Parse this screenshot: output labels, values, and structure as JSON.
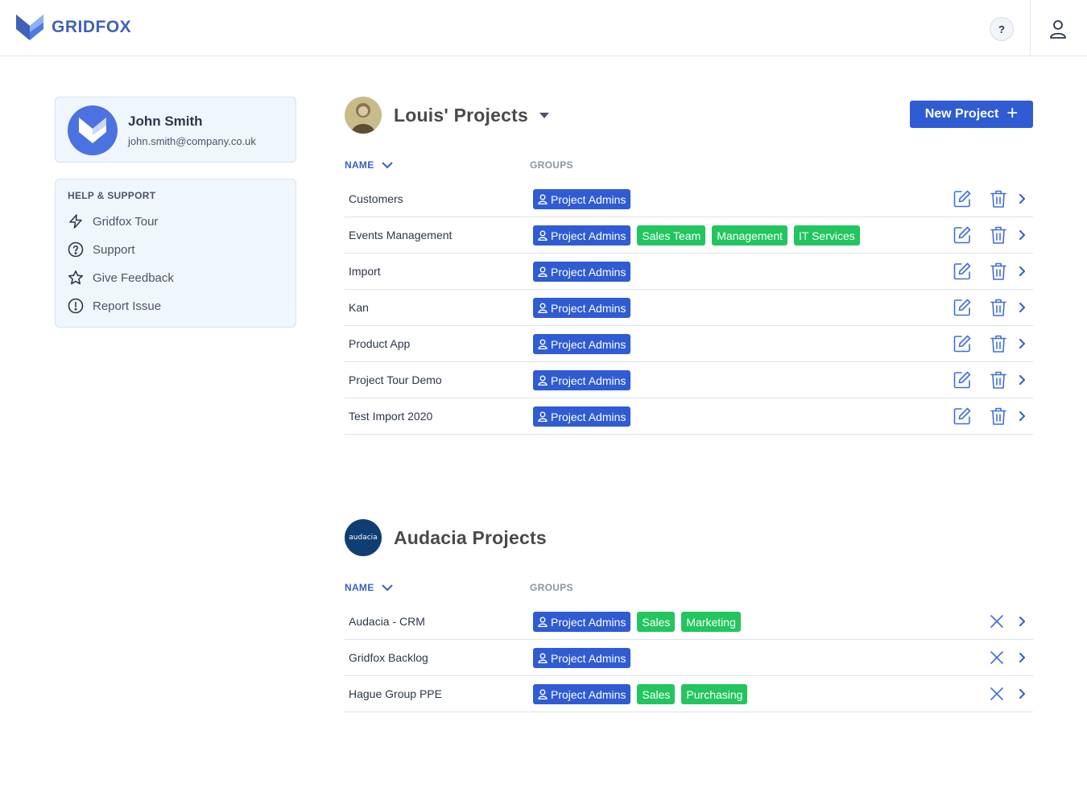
{
  "app": {
    "logo_text": "GRIDFOX",
    "help_label": "?"
  },
  "colors": {
    "primary": "#2f5bd3",
    "green": "#22c55e",
    "panel_bg": "#f0f6fe",
    "accent_text": "#3660c9"
  },
  "profile": {
    "name": "John Smith",
    "email": "john.smith@company.co.uk"
  },
  "help": {
    "title": "HELP & SUPPORT",
    "items": [
      {
        "label": "Gridfox Tour",
        "icon": "lightning-icon"
      },
      {
        "label": "Support",
        "icon": "question-circle-icon"
      },
      {
        "label": "Give Feedback",
        "icon": "star-icon"
      },
      {
        "label": "Report Issue",
        "icon": "exclamation-circle-icon"
      }
    ]
  },
  "workspaces": [
    {
      "title": "Louis' Projects",
      "new_project_label": "New Project",
      "columns": {
        "name": "NAME",
        "groups": "GROUPS"
      },
      "projects": [
        {
          "name": "Customers",
          "groups": [
            "Project Admins"
          ]
        },
        {
          "name": "Events Management",
          "groups": [
            "Project Admins",
            "Sales Team",
            "Management",
            "IT Services"
          ]
        },
        {
          "name": "Import",
          "groups": [
            "Project Admins"
          ]
        },
        {
          "name": "Kan",
          "groups": [
            "Project Admins"
          ]
        },
        {
          "name": "Product App",
          "groups": [
            "Project Admins"
          ]
        },
        {
          "name": "Project Tour Demo",
          "groups": [
            "Project Admins"
          ]
        },
        {
          "name": "Test Import 2020",
          "groups": [
            "Project Admins"
          ]
        }
      ]
    },
    {
      "title": "Audacia Projects",
      "avatar_text": "audacia",
      "columns": {
        "name": "NAME",
        "groups": "GROUPS"
      },
      "projects": [
        {
          "name": "Audacia - CRM",
          "groups": [
            "Project Admins",
            "Sales",
            "Marketing"
          ]
        },
        {
          "name": "Gridfox Backlog",
          "groups": [
            "Project Admins"
          ]
        },
        {
          "name": "Hague Group PPE",
          "groups": [
            "Project Admins",
            "Sales",
            "Purchasing"
          ]
        }
      ]
    }
  ]
}
